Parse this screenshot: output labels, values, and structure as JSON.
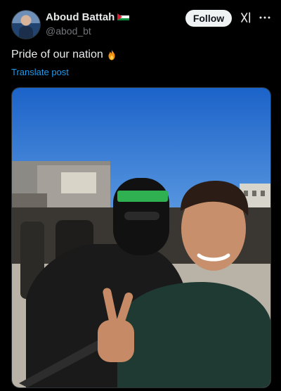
{
  "author": {
    "display_name": "Aboud Battah",
    "handle": "@abod_bt",
    "flag_icon": "palestine-flag-icon"
  },
  "actions": {
    "follow_label": "Follow",
    "grok_icon": "grok-icon",
    "more_icon": "more-options-icon"
  },
  "post": {
    "text": "Pride of our nation",
    "emoji_icon": "fire-emoji-icon",
    "translate_label": "Translate post"
  },
  "media": {
    "type": "photo",
    "icon": "post-photo"
  },
  "colors": {
    "background": "#000000",
    "text": "#e7e9ea",
    "secondary_text": "#71767b",
    "link": "#1d9bf0",
    "follow_button_bg": "#eff3f4"
  }
}
